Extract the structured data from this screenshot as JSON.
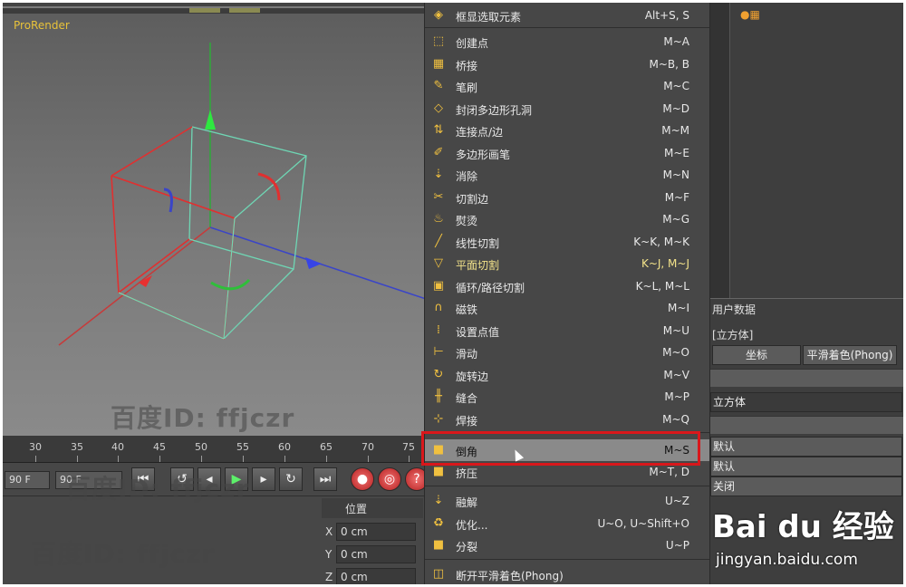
{
  "viewport": {
    "title": "ProRender"
  },
  "timeline": {
    "ticks": [
      "30",
      "35",
      "40",
      "45",
      "50",
      "55",
      "60",
      "65",
      "70",
      "75"
    ]
  },
  "playback": {
    "frame_start": "90 F",
    "frame_end": "90 F"
  },
  "coords": {
    "header": "位置",
    "rows": [
      {
        "axis": "X",
        "value": "0 cm"
      },
      {
        "axis": "Y",
        "value": "0 cm"
      },
      {
        "axis": "Z",
        "value": "0 cm"
      }
    ]
  },
  "menu": {
    "items": [
      {
        "label": "框显选取元素",
        "shortcut": "Alt+S, S",
        "icon": "frame-select-icon"
      },
      {
        "label": "创建点",
        "shortcut": "M~A",
        "icon": "create-point-icon"
      },
      {
        "label": "桥接",
        "shortcut": "M~B, B",
        "icon": "bridge-icon"
      },
      {
        "label": "笔刷",
        "shortcut": "M~C",
        "icon": "brush-icon"
      },
      {
        "label": "封闭多边形孔洞",
        "shortcut": "M~D",
        "icon": "close-hole-icon"
      },
      {
        "label": "连接点/边",
        "shortcut": "M~M",
        "icon": "connect-icon"
      },
      {
        "label": "多边形画笔",
        "shortcut": "M~E",
        "icon": "polygon-pen-icon"
      },
      {
        "label": "消除",
        "shortcut": "M~N",
        "icon": "dissolve-icon"
      },
      {
        "label": "切割边",
        "shortcut": "M~F",
        "icon": "cut-edge-icon"
      },
      {
        "label": "熨烫",
        "shortcut": "M~G",
        "icon": "iron-icon"
      },
      {
        "label": "线性切割",
        "shortcut": "K~K, M~K",
        "icon": "knife-line-icon"
      },
      {
        "label": "平面切割",
        "shortcut": "K~J, M~J",
        "icon": "knife-plane-icon"
      },
      {
        "label": "循环/路径切割",
        "shortcut": "K~L, M~L",
        "icon": "loop-cut-icon"
      },
      {
        "label": "磁铁",
        "shortcut": "M~I",
        "icon": "magnet-icon"
      },
      {
        "label": "设置点值",
        "shortcut": "M~U",
        "icon": "set-point-icon"
      },
      {
        "label": "滑动",
        "shortcut": "M~O",
        "icon": "slide-icon"
      },
      {
        "label": "旋转边",
        "shortcut": "M~V",
        "icon": "spin-edge-icon"
      },
      {
        "label": "缝合",
        "shortcut": "M~P",
        "icon": "stitch-icon"
      },
      {
        "label": "焊接",
        "shortcut": "M~Q",
        "icon": "weld-icon"
      },
      {
        "label": "倒角",
        "shortcut": "M~S",
        "icon": "bevel-icon"
      },
      {
        "label": "挤压",
        "shortcut": "M~T, D",
        "icon": "extrude-icon"
      },
      {
        "label": "融解",
        "shortcut": "U~Z",
        "icon": "melt-icon"
      },
      {
        "label": "优化...",
        "shortcut": "U~O, U~Shift+O",
        "icon": "optimize-icon"
      },
      {
        "label": "分裂",
        "shortcut": "U~P",
        "icon": "split-icon"
      },
      {
        "label": "断开平滑着色(Phong)",
        "shortcut": "",
        "icon": "break-phong-icon"
      }
    ]
  },
  "right_panel": {
    "section": "用户数据",
    "object_label": "[立方体]",
    "tab_coord": "坐标",
    "tab_phong": "平滑着色(Phong)",
    "name_value": "立方体",
    "layer1": "默认",
    "layer2": "默认",
    "state": "关闭"
  },
  "watermark": {
    "text": "百度ID: ffjczr",
    "brand": "Bai du 经验",
    "url": "jingyan.baidu.com"
  }
}
